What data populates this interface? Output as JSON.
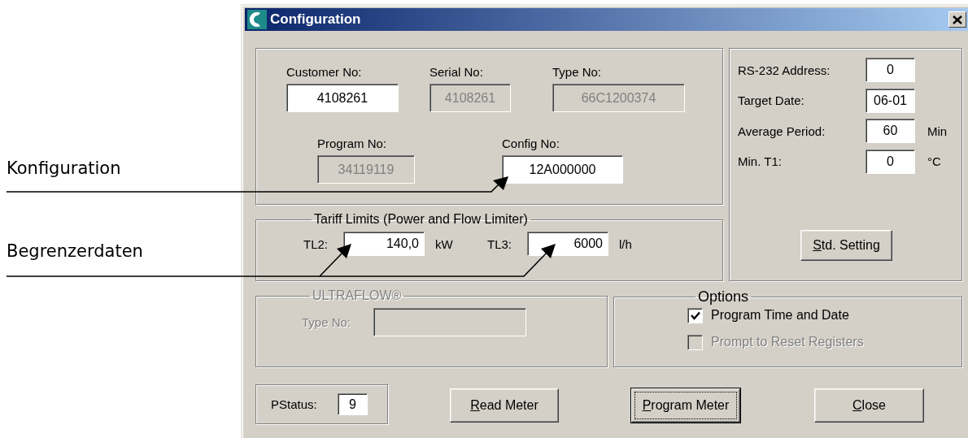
{
  "annotations": [
    {
      "label": "Konfiguration"
    },
    {
      "label": "Begrenzerdaten"
    }
  ],
  "window": {
    "title": "Configuration"
  },
  "identification": {
    "rows": [
      [
        {
          "label": "Customer No:",
          "value": "4108261",
          "disabled": false
        },
        {
          "label": "Serial No:",
          "value": "4108261",
          "disabled": true
        },
        {
          "label": "Type No:",
          "value": "66C1200374",
          "disabled": true
        }
      ],
      [
        {
          "label": "Program No:",
          "value": "34119119",
          "disabled": true
        },
        {
          "label": "Config No:",
          "value": "12A000000",
          "disabled": false
        }
      ]
    ]
  },
  "settings": {
    "fields": [
      {
        "label": "RS-232 Address:",
        "value": "0"
      },
      {
        "label": "Target Date:",
        "value": "06-01"
      },
      {
        "label": "Average Period:",
        "value": "60",
        "unit": "Min"
      },
      {
        "label": "Min. T1:",
        "value": "0",
        "unit": "°C"
      }
    ],
    "button": {
      "label": "Std. Setting"
    }
  },
  "tariff_limits": {
    "title": "Tariff Limits (Power and Flow Limiter)",
    "fields": [
      {
        "label": "TL2:",
        "value": "140,0",
        "unit": "kW"
      },
      {
        "label": "TL3:",
        "value": "6000",
        "unit": "l/h"
      }
    ]
  },
  "ultraflow": {
    "title": "ULTRAFLOW®",
    "disabled": true,
    "fields": [
      {
        "label": "Type No:"
      }
    ]
  },
  "options": {
    "title": "Options",
    "items": [
      {
        "label": "Program Time and Date",
        "checked": true,
        "disabled": false
      },
      {
        "label": "Prompt to Reset Registers",
        "checked": false,
        "disabled": true
      }
    ]
  },
  "pstatus": {
    "label": "PStatus:",
    "value": "9"
  },
  "buttons": [
    {
      "label": "Read Meter",
      "default": false
    },
    {
      "label": "Program Meter",
      "default": true
    },
    {
      "label": "Close",
      "default": false
    }
  ]
}
